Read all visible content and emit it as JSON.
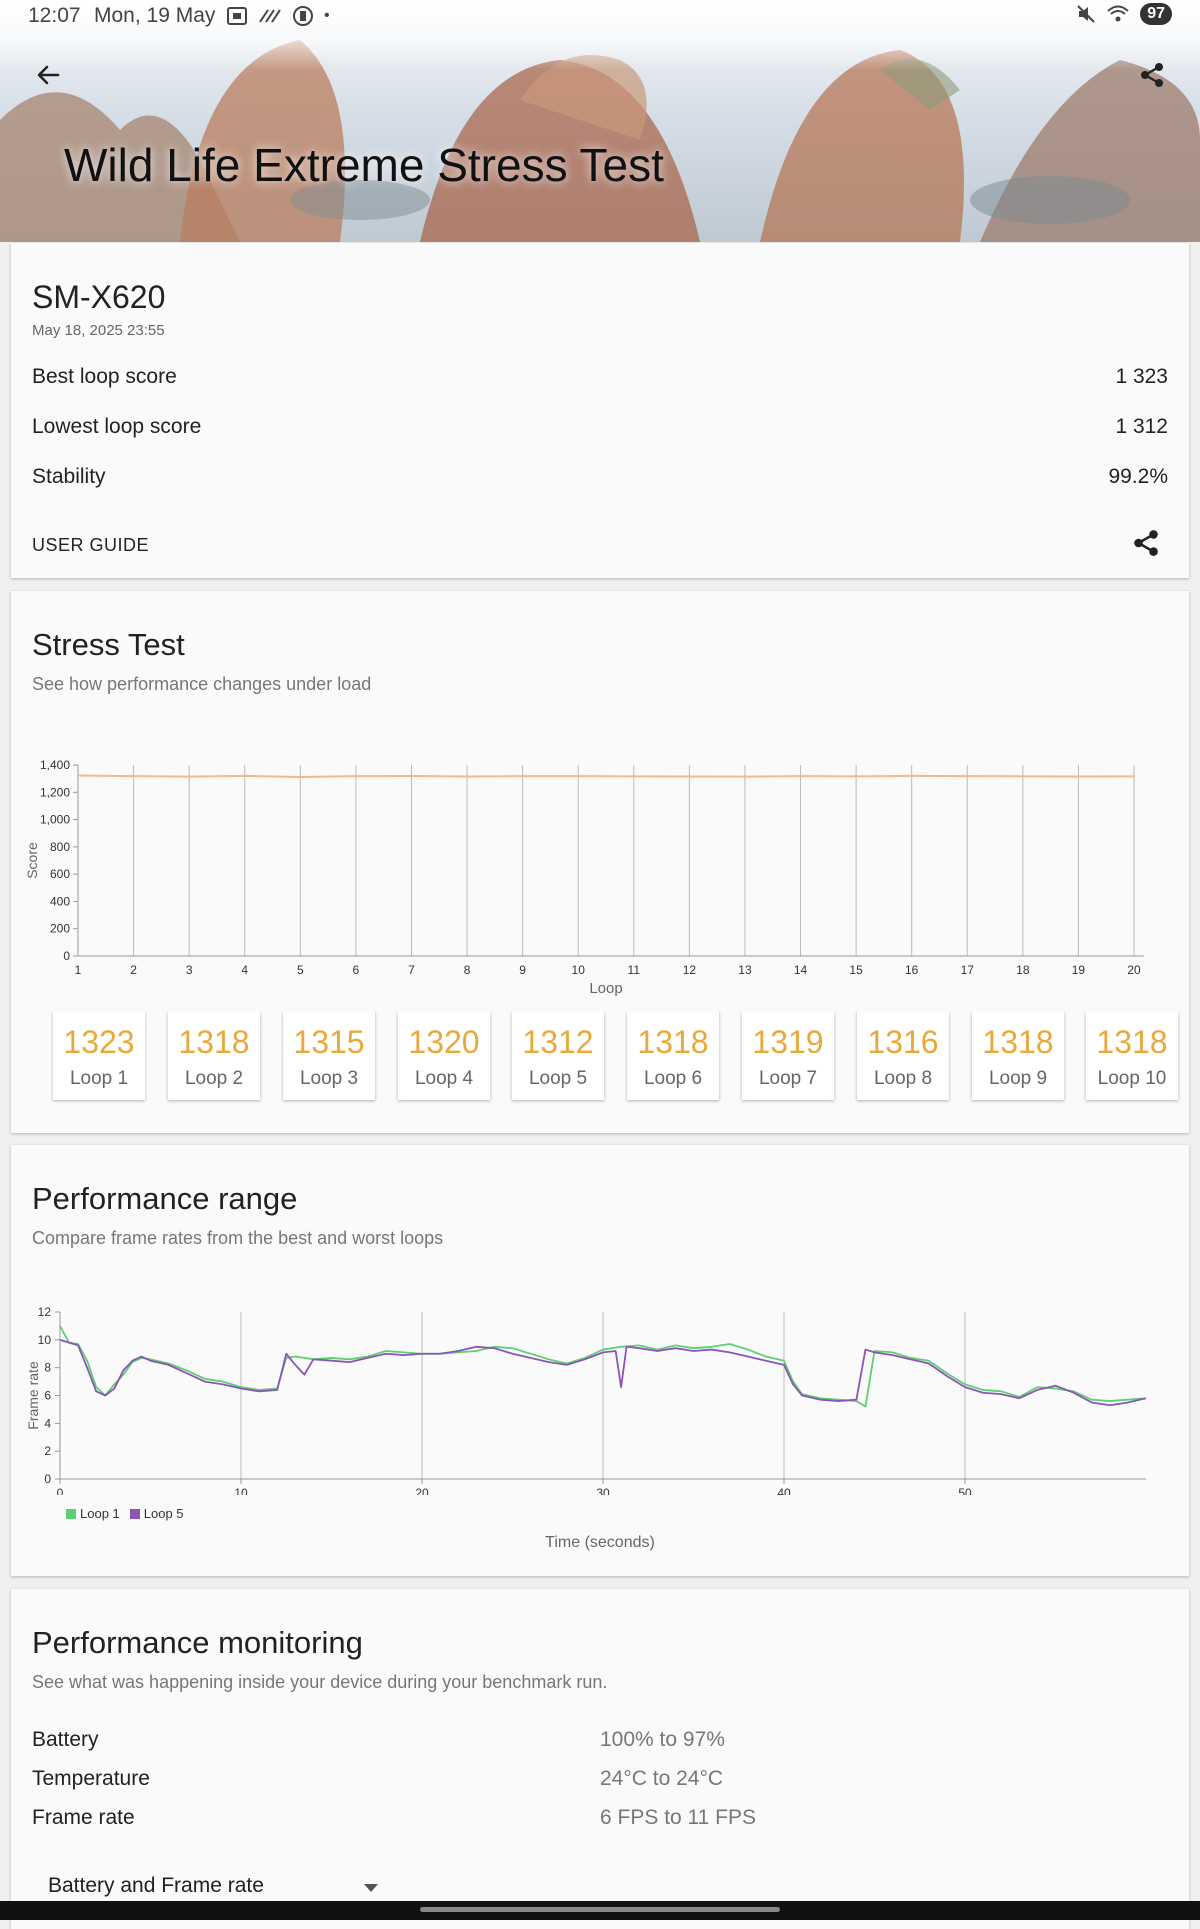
{
  "status_bar": {
    "time": "12:07",
    "date": "Mon, 19 May",
    "battery": "97",
    "icons_left": [
      "screenshot-icon",
      "wifi-calling-icon",
      "vibrate-icon",
      "dot-icon"
    ],
    "icons_right": [
      "mute-icon",
      "wifi-icon",
      "battery-icon"
    ]
  },
  "header": {
    "title": "Wild Life Extreme Stress Test",
    "back_icon": "back-arrow-icon",
    "share_icon": "share-icon"
  },
  "summary": {
    "device": "SM-X620",
    "date": "May 18, 2025 23:55",
    "rows": [
      {
        "label": "Best loop score",
        "value": "1 323"
      },
      {
        "label": "Lowest loop score",
        "value": "1 312"
      },
      {
        "label": "Stability",
        "value": "99.2%"
      }
    ],
    "user_guide": "USER GUIDE"
  },
  "stress_test": {
    "title": "Stress Test",
    "subtitle": "See how performance changes under load",
    "tiles": [
      {
        "score": "1323",
        "label": "Loop 1"
      },
      {
        "score": "1318",
        "label": "Loop 2"
      },
      {
        "score": "1315",
        "label": "Loop 3"
      },
      {
        "score": "1320",
        "label": "Loop 4"
      },
      {
        "score": "1312",
        "label": "Loop 5"
      },
      {
        "score": "1318",
        "label": "Loop 6"
      },
      {
        "score": "1319",
        "label": "Loop 7"
      },
      {
        "score": "1316",
        "label": "Loop 8"
      },
      {
        "score": "1318",
        "label": "Loop 9"
      },
      {
        "score": "1318",
        "label": "Loop 10"
      }
    ]
  },
  "performance_range": {
    "title": "Performance range",
    "subtitle": "Compare frame rates from the best and worst loops",
    "legend": [
      {
        "name": "Loop 1",
        "color": "#5fcf6f"
      },
      {
        "name": "Loop 5",
        "color": "#8b55b8"
      }
    ],
    "xaxis_title": "Time (seconds)"
  },
  "monitoring": {
    "title": "Performance monitoring",
    "subtitle": "See what was happening inside your device during your benchmark run.",
    "rows": [
      {
        "label": "Battery",
        "value": "100% to 97%"
      },
      {
        "label": "Temperature",
        "value": "24°C to 24°C"
      },
      {
        "label": "Frame rate",
        "value": "6 FPS to 11 FPS"
      }
    ],
    "dropdown": "Battery and Frame rate"
  },
  "chart_data": [
    {
      "type": "line",
      "xlabel": "Loop",
      "ylabel": "Score",
      "x": [
        1,
        2,
        3,
        4,
        5,
        6,
        7,
        8,
        9,
        10,
        11,
        12,
        13,
        14,
        15,
        16,
        17,
        18,
        19,
        20
      ],
      "series": [
        {
          "values": [
            1323,
            1318,
            1315,
            1320,
            1312,
            1318,
            1319,
            1316,
            1318,
            1318,
            1317,
            1316,
            1315,
            1318,
            1317,
            1320,
            1318,
            1317,
            1316,
            1317
          ],
          "color": "#f0b98c"
        }
      ],
      "ylim": [
        0,
        1400
      ],
      "yticks": [
        0,
        200,
        400,
        600,
        800,
        1000,
        1200,
        1400
      ],
      "ytick_labels": [
        "0",
        "200",
        "400",
        "600",
        "800",
        "1,000",
        "1,200",
        "1,400"
      ],
      "xticks": [
        1,
        2,
        3,
        4,
        5,
        6,
        7,
        8,
        9,
        10,
        11,
        12,
        13,
        14,
        15,
        16,
        17,
        18,
        19,
        20
      ],
      "grid": "vertical"
    },
    {
      "type": "line",
      "xlabel": "Time (seconds)",
      "ylabel": "Frame rate",
      "xlim": [
        0,
        60
      ],
      "ylim": [
        0,
        12
      ],
      "xticks": [
        0,
        10,
        20,
        30,
        40,
        50
      ],
      "yticks": [
        0,
        2,
        4,
        6,
        8,
        10,
        12
      ],
      "grid": "vertical",
      "legend": "bottom-left",
      "series": [
        {
          "name": "Loop 1",
          "color": "#5fcf6f",
          "points": [
            [
              0,
              11
            ],
            [
              0.5,
              9.8
            ],
            [
              1,
              9.7
            ],
            [
              1.5,
              8.5
            ],
            [
              2,
              6.6
            ],
            [
              2.5,
              6
            ],
            [
              3,
              6.8
            ],
            [
              3.5,
              7.5
            ],
            [
              4,
              8.4
            ],
            [
              4.5,
              8.7
            ],
            [
              5,
              8.6
            ],
            [
              6,
              8.3
            ],
            [
              7,
              7.8
            ],
            [
              8,
              7.2
            ],
            [
              9,
              7
            ],
            [
              10,
              6.6
            ],
            [
              11,
              6.4
            ],
            [
              12,
              6.5
            ],
            [
              12.5,
              8.7
            ],
            [
              13,
              8.8
            ],
            [
              14,
              8.6
            ],
            [
              15,
              8.7
            ],
            [
              16,
              8.6
            ],
            [
              17,
              8.8
            ],
            [
              18,
              9.2
            ],
            [
              19,
              9.1
            ],
            [
              20,
              9
            ],
            [
              21,
              9
            ],
            [
              22,
              9.1
            ],
            [
              23,
              9.2
            ],
            [
              24,
              9.5
            ],
            [
              25,
              9.4
            ],
            [
              26,
              9
            ],
            [
              27,
              8.6
            ],
            [
              28,
              8.3
            ],
            [
              29,
              8.7
            ],
            [
              30,
              9.3
            ],
            [
              31,
              9.5
            ],
            [
              32,
              9.6
            ],
            [
              33,
              9.3
            ],
            [
              34,
              9.6
            ],
            [
              35,
              9.4
            ],
            [
              36,
              9.5
            ],
            [
              37,
              9.7
            ],
            [
              38,
              9.3
            ],
            [
              39,
              8.8
            ],
            [
              40,
              8.5
            ],
            [
              40.5,
              7
            ],
            [
              41,
              6.1
            ],
            [
              42,
              5.8
            ],
            [
              43,
              5.7
            ],
            [
              44,
              5.6
            ],
            [
              44.5,
              5.2
            ],
            [
              45,
              9.2
            ],
            [
              46,
              9.1
            ],
            [
              47,
              8.7
            ],
            [
              48,
              8.5
            ],
            [
              49,
              7.6
            ],
            [
              50,
              6.8
            ],
            [
              51,
              6.4
            ],
            [
              52,
              6.3
            ],
            [
              53,
              5.9
            ],
            [
              54,
              6.6
            ],
            [
              55,
              6.5
            ],
            [
              56,
              6.3
            ],
            [
              57,
              5.7
            ],
            [
              58,
              5.6
            ],
            [
              59,
              5.7
            ],
            [
              60,
              5.8
            ]
          ]
        },
        {
          "name": "Loop 5",
          "color": "#8b55b8",
          "points": [
            [
              0,
              10
            ],
            [
              0.5,
              9.8
            ],
            [
              1,
              9.6
            ],
            [
              1.5,
              8
            ],
            [
              2,
              6.3
            ],
            [
              2.5,
              6
            ],
            [
              3,
              6.5
            ],
            [
              3.5,
              7.8
            ],
            [
              4,
              8.5
            ],
            [
              4.5,
              8.8
            ],
            [
              5,
              8.5
            ],
            [
              6,
              8.2
            ],
            [
              7,
              7.6
            ],
            [
              8,
              7
            ],
            [
              9,
              6.8
            ],
            [
              10,
              6.5
            ],
            [
              11,
              6.3
            ],
            [
              12,
              6.4
            ],
            [
              12.5,
              9
            ],
            [
              13,
              8.2
            ],
            [
              13.5,
              7.5
            ],
            [
              14,
              8.6
            ],
            [
              15,
              8.5
            ],
            [
              16,
              8.4
            ],
            [
              17,
              8.7
            ],
            [
              18,
              9
            ],
            [
              19,
              8.9
            ],
            [
              20,
              9
            ],
            [
              21,
              9
            ],
            [
              22,
              9.2
            ],
            [
              23,
              9.5
            ],
            [
              24,
              9.4
            ],
            [
              25,
              9
            ],
            [
              26,
              8.7
            ],
            [
              27,
              8.4
            ],
            [
              28,
              8.2
            ],
            [
              29,
              8.6
            ],
            [
              30,
              9.1
            ],
            [
              30.7,
              9.2
            ],
            [
              31,
              6.6
            ],
            [
              31.3,
              9.5
            ],
            [
              32,
              9.4
            ],
            [
              33,
              9.2
            ],
            [
              34,
              9.4
            ],
            [
              35,
              9.2
            ],
            [
              36,
              9.3
            ],
            [
              37,
              9.1
            ],
            [
              38,
              8.8
            ],
            [
              39,
              8.5
            ],
            [
              40,
              8.2
            ],
            [
              40.5,
              6.8
            ],
            [
              41,
              6
            ],
            [
              42,
              5.7
            ],
            [
              43,
              5.6
            ],
            [
              44,
              5.7
            ],
            [
              44.5,
              9.3
            ],
            [
              45,
              9.1
            ],
            [
              46,
              8.9
            ],
            [
              47,
              8.6
            ],
            [
              48,
              8.3
            ],
            [
              49,
              7.4
            ],
            [
              50,
              6.6
            ],
            [
              51,
              6.2
            ],
            [
              52,
              6.1
            ],
            [
              53,
              5.8
            ],
            [
              54,
              6.4
            ],
            [
              55,
              6.7
            ],
            [
              56,
              6.2
            ],
            [
              57,
              5.5
            ],
            [
              58,
              5.3
            ],
            [
              59,
              5.5
            ],
            [
              60,
              5.8
            ]
          ]
        }
      ]
    }
  ]
}
